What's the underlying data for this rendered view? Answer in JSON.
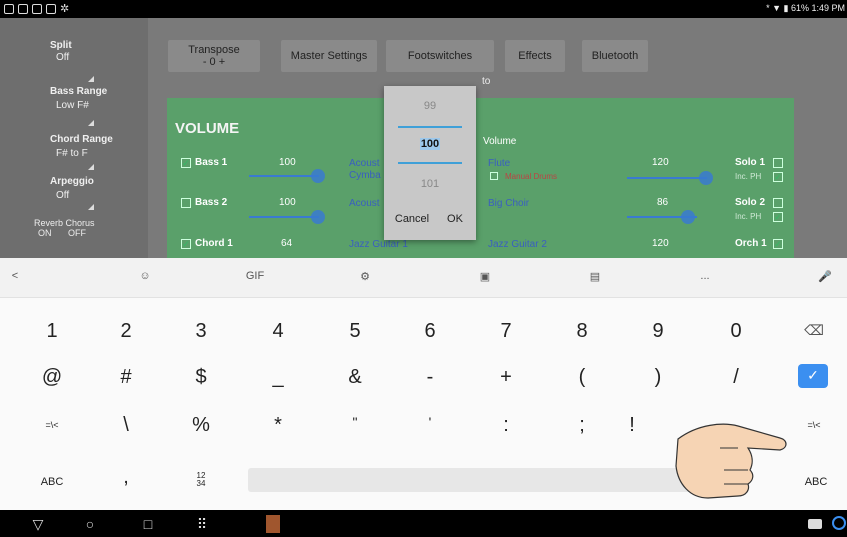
{
  "status_bar": {
    "right_text": "* ▼ ▮ 61% 1:49 PM"
  },
  "left_panel": {
    "split_label": "Split",
    "split_value": "Off",
    "bass_range_label": "Bass Range",
    "bass_range_value": "Low F#",
    "chord_range_label": "Chord Range",
    "chord_range_value": "F# to F",
    "arpeggio_label": "Arpeggio",
    "arpeggio_value": "Off",
    "reverb_chorus_label": "Reverb Chorus",
    "reverb_on": "ON",
    "reverb_off": "OFF"
  },
  "top_buttons": {
    "transpose": "Transpose",
    "transpose_value": "-  0  +",
    "master": "Master Settings",
    "footswitches": "Footswitches",
    "effects": "Effects",
    "bluetooth": "Bluetooth",
    "auto_hint": "to"
  },
  "volume": {
    "title": "VOLUME",
    "volume_label": "Volume",
    "rows": [
      {
        "label": "Bass 1",
        "value": "100",
        "inst1": "Acoust",
        "inst1b": "Cymba",
        "inst2": "Flute",
        "inst2_note": "Manual Drums",
        "value2": "120",
        "solo": "Solo 1",
        "inc": "Inc. PH"
      },
      {
        "label": "Bass 2",
        "value": "100",
        "inst1": "Acoust",
        "inst2": "Big Choir",
        "value2": "86",
        "solo": "Solo 2",
        "inc": "Inc. PH"
      },
      {
        "label": "Chord 1",
        "value": "64",
        "inst1": "Jazz Guitar 1",
        "inst2": "Jazz Guitar 2",
        "value2": "120",
        "solo": "Orch 1"
      }
    ]
  },
  "dialog": {
    "prev": "99",
    "current": "100",
    "next": "101",
    "cancel": "Cancel",
    "ok": "OK"
  },
  "keyboard": {
    "toolbar": [
      "<",
      "☺",
      "GIF",
      "⚙",
      "▣",
      "▤",
      "...",
      "🎤"
    ],
    "row1": [
      "1",
      "2",
      "3",
      "4",
      "5",
      "6",
      "7",
      "8",
      "9",
      "0",
      "⌫"
    ],
    "row2": [
      "@",
      "#",
      "$",
      "_",
      "&",
      "-",
      "+",
      "(",
      ")",
      "/"
    ],
    "row3": [
      "=\\<",
      "\\",
      "%",
      "*",
      "\"",
      "'",
      ":",
      ";",
      "!",
      "=\\<"
    ],
    "row4_left": "ABC",
    "row4_comma": ",",
    "row4_numpad": "12\n34",
    "row4_right": "ABC",
    "enter": "✓"
  },
  "nav_bar": {
    "back": "▽",
    "home": "○",
    "recent": "□",
    "apps": "⠿"
  }
}
